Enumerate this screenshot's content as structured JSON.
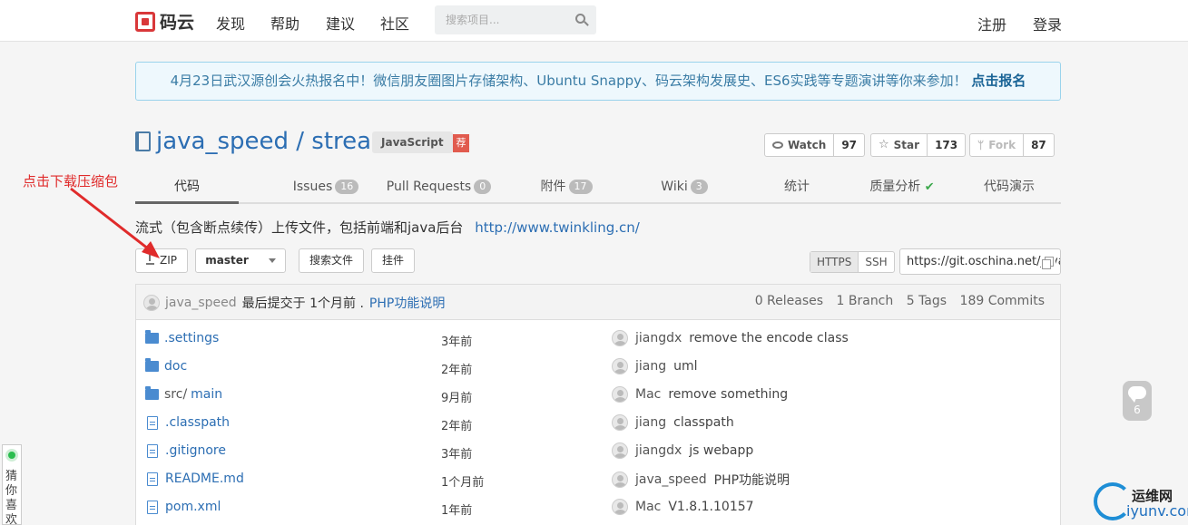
{
  "topnav": {
    "logo_text": "码云",
    "items": [
      "发现",
      "帮助",
      "建议",
      "社区"
    ],
    "search_placeholder": "搜索项目...",
    "register": "注册",
    "login": "登录"
  },
  "announcement": {
    "text": "4月23日武汉源创会火热报名中！微信朋友圈图片存储架构、Ubuntu Snappy、码云架构发展史、ES6实践等专题演讲等你来参加！",
    "link": "点击报名"
  },
  "repo": {
    "name": "java_speed / stream",
    "language": "JavaScript",
    "recommend_badge": "荐",
    "watch_label": "Watch",
    "watch_count": "97",
    "star_label": "Star",
    "star_count": "173",
    "fork_label": "Fork",
    "fork_count": "87"
  },
  "tabs": {
    "code": "代码",
    "issues": "Issues",
    "issues_count": "16",
    "pulls": "Pull Requests",
    "pulls_count": "0",
    "attach": "附件",
    "attach_count": "17",
    "wiki": "Wiki",
    "wiki_count": "3",
    "stats": "统计",
    "quality": "质量分析",
    "demo": "代码演示"
  },
  "description": {
    "text": "流式（包含断点续传）上传文件，包括前端和java后台",
    "url": "http://www.twinkling.cn/"
  },
  "toolbar": {
    "zip": "ZIP",
    "branch": "master",
    "search_files": "搜索文件",
    "widget": "挂件",
    "https": "HTTPS",
    "ssh": "SSH",
    "clone_url": "https://git.oschina.net/java_speed/stream.git"
  },
  "last_commit": {
    "author": "java_speed",
    "text": "最后提交于 1个月前 .",
    "message": "PHP功能说明",
    "releases": "0 Releases",
    "branches": "1 Branch",
    "tags": "5 Tags",
    "commits": "189 Commits"
  },
  "files": [
    {
      "name": ".settings",
      "time": "3年前",
      "author": "jiangdx",
      "message": "remove the encode class"
    },
    {
      "name": "doc",
      "time": "2年前",
      "author": "jiang",
      "message": "uml"
    },
    {
      "name_prefix": "src/",
      "name": "main",
      "time": "9月前",
      "author": "Mac",
      "message": "remove something"
    },
    {
      "name": ".classpath",
      "time": "2年前",
      "author": "jiang",
      "message": "classpath"
    },
    {
      "name": ".gitignore",
      "time": "3年前",
      "author": "jiangdx",
      "message": "js webapp"
    },
    {
      "name": "README.md",
      "time": "1个月前",
      "author": "java_speed",
      "message": "PHP功能说明"
    },
    {
      "name": "pom.xml",
      "time": "1年前",
      "author": "Mac",
      "message": "V1.8.1.10157"
    }
  ],
  "annotation": "点击下载压缩包",
  "feedback_count": "6",
  "guess_widget": "猜你喜欢",
  "watermark": {
    "cn": "运维网",
    "en": "iyunv.com"
  }
}
